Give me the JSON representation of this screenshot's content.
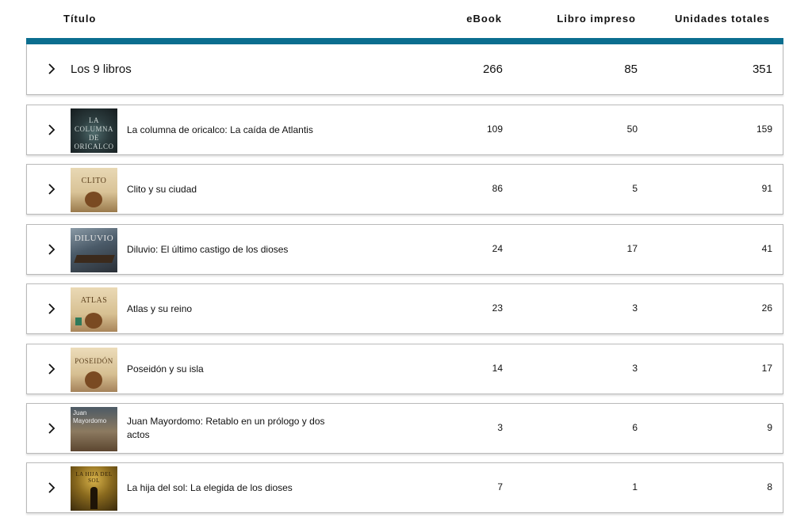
{
  "header": {
    "title_col": "Título",
    "ebook_col": "eBook",
    "print_col": "Libro impreso",
    "total_col": "Unidades totales"
  },
  "colors": {
    "accent_bar": "#0b6e8f",
    "row_border": "#b9b9b9"
  },
  "summary": {
    "label": "Los 9 libros",
    "ebook": "266",
    "print": "85",
    "total": "351"
  },
  "books": [
    {
      "title": "La columna de oricalco: La caída de Atlantis",
      "cover_text": "LA COLUMNA DE ORICALCO",
      "ebook": "109",
      "print": "50",
      "total": "159"
    },
    {
      "title": "Clito y su ciudad",
      "cover_text": "CLITO",
      "ebook": "86",
      "print": "5",
      "total": "91"
    },
    {
      "title": "Diluvio: El último castigo de los dioses",
      "cover_text": "DILUVIO",
      "ebook": "24",
      "print": "17",
      "total": "41"
    },
    {
      "title": "Atlas y su reino",
      "cover_text": "ATLAS",
      "ebook": "23",
      "print": "3",
      "total": "26"
    },
    {
      "title": "Poseidón y su isla",
      "cover_text": "POSEIDÓN",
      "ebook": "14",
      "print": "3",
      "total": "17"
    },
    {
      "title": "Juan Mayordomo: Retablo en un prólogo y dos actos",
      "cover_text": "Juan Mayordomo",
      "ebook": "3",
      "print": "6",
      "total": "9"
    },
    {
      "title": "La hija del sol: La elegida de los dioses",
      "cover_text": "LA HIJA DEL SOL",
      "ebook": "7",
      "print": "1",
      "total": "8"
    }
  ]
}
